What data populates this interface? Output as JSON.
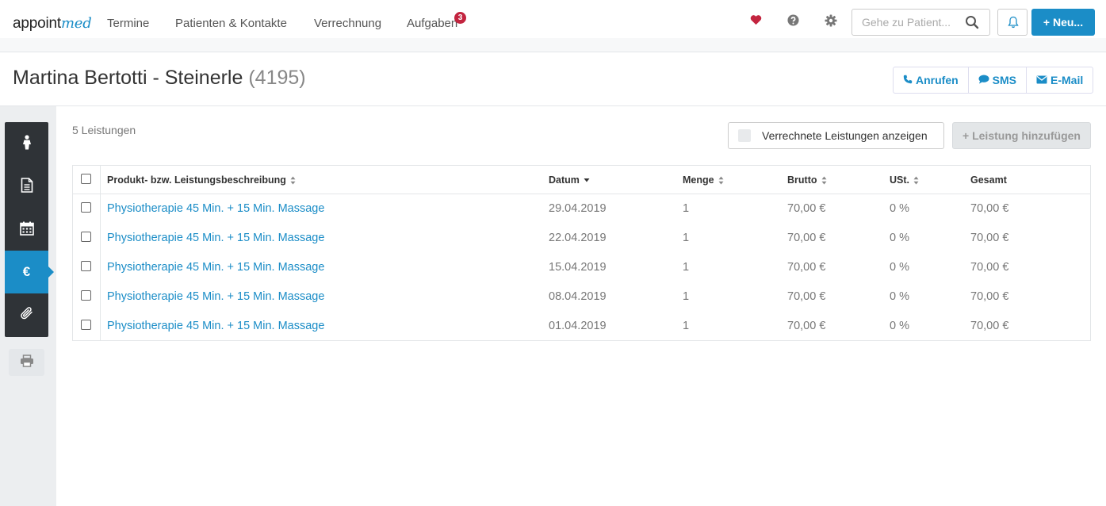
{
  "brand": {
    "logo_main": "appoint",
    "logo_accent": "med"
  },
  "nav": {
    "items": [
      "Termine",
      "Patienten & Kontakte",
      "Verrechnung",
      "Aufgaben"
    ],
    "tasks_badge": "3"
  },
  "search": {
    "placeholder": "Gehe zu Patient..."
  },
  "new_button": "Neu...",
  "patient": {
    "name": "Martina Bertotti - Steinerle",
    "id": "(4195)"
  },
  "contact_actions": {
    "call": "Anrufen",
    "sms": "SMS",
    "email": "E-Mail"
  },
  "services": {
    "count_label": "5 Leistungen",
    "show_billed_label": "Verrechnete Leistungen anzeigen",
    "add_label": "+ Leistung hinzufügen",
    "columns": {
      "description": "Produkt- bzw. Leistungsbeschreibung",
      "date": "Datum",
      "quantity": "Menge",
      "gross": "Brutto",
      "vat": "USt.",
      "total": "Gesamt"
    },
    "rows": [
      {
        "description": "Physiotherapie 45 Min. + 15 Min. Massage",
        "date": "29.04.2019",
        "quantity": "1",
        "gross": "70,00 €",
        "vat": "0 %",
        "total": "70,00 €"
      },
      {
        "description": "Physiotherapie 45 Min. + 15 Min. Massage",
        "date": "22.04.2019",
        "quantity": "1",
        "gross": "70,00 €",
        "vat": "0 %",
        "total": "70,00 €"
      },
      {
        "description": "Physiotherapie 45 Min. + 15 Min. Massage",
        "date": "15.04.2019",
        "quantity": "1",
        "gross": "70,00 €",
        "vat": "0 %",
        "total": "70,00 €"
      },
      {
        "description": "Physiotherapie 45 Min. + 15 Min. Massage",
        "date": "08.04.2019",
        "quantity": "1",
        "gross": "70,00 €",
        "vat": "0 %",
        "total": "70,00 €"
      },
      {
        "description": "Physiotherapie 45 Min. + 15 Min. Massage",
        "date": "01.04.2019",
        "quantity": "1",
        "gross": "70,00 €",
        "vat": "0 %",
        "total": "70,00 €"
      }
    ]
  },
  "sidebar": {
    "items": [
      "person-icon",
      "document-icon",
      "calendar-icon",
      "euro-icon",
      "paperclip-icon"
    ],
    "active": "euro-icon",
    "euro_glyph": "€"
  },
  "colors": {
    "accent": "#1b8dc7",
    "badge": "#c3243f",
    "heart": "#c3243f",
    "sidebar": "#2f3337"
  }
}
